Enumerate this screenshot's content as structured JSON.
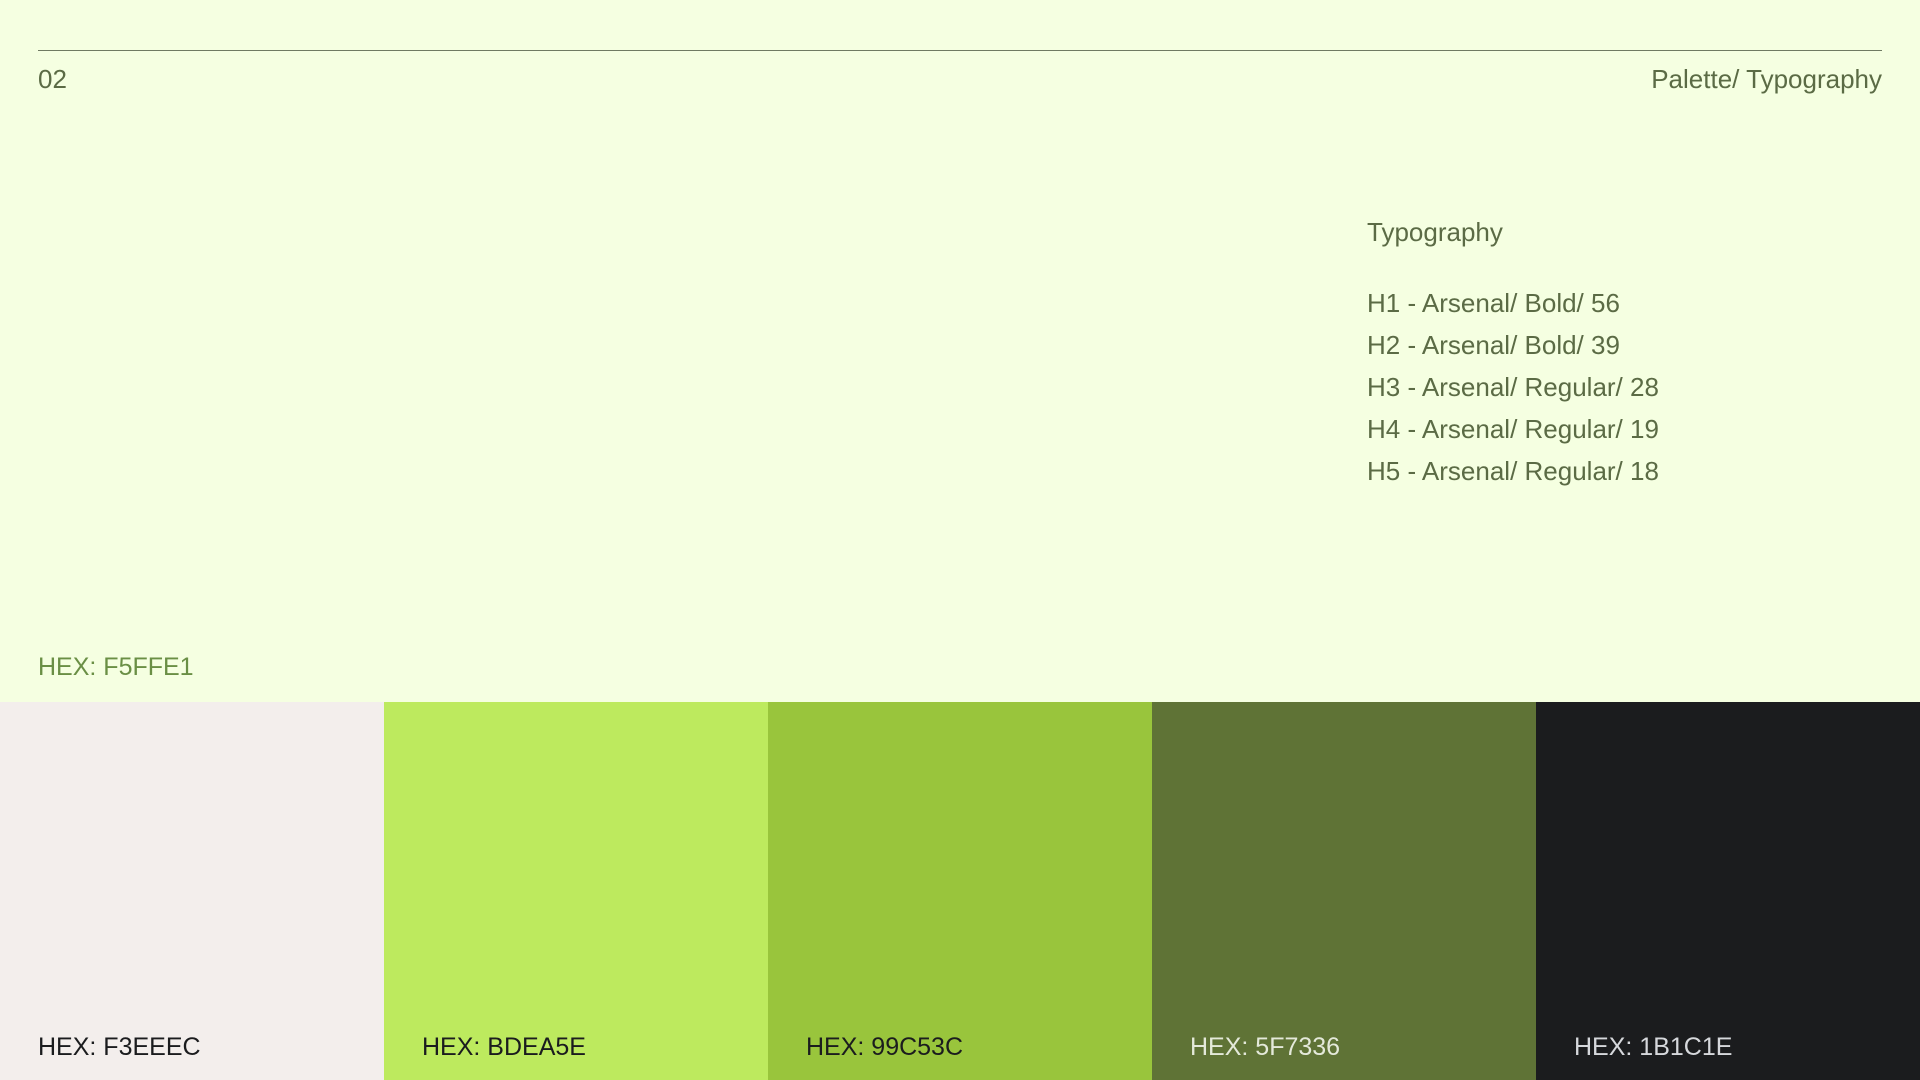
{
  "header": {
    "page_number": "02",
    "section_title": "Palette/ Typography"
  },
  "typography": {
    "heading": "Typography",
    "items": [
      "H1 - Arsenal/ Bold/ 56",
      "H2 - Arsenal/ Bold/ 39",
      "H3 - Arsenal/ Regular/ 28",
      "H4 - Arsenal/ Regular/ 19",
      "H5 - Arsenal/ Regular/ 18"
    ]
  },
  "palette": {
    "background": {
      "label": "HEX: F5FFE1",
      "color": "#F5FFE1"
    },
    "swatches": [
      {
        "label": "HEX: F3EEEC",
        "color": "#F3EEEC",
        "text_color": "#1B1C1E"
      },
      {
        "label": "HEX: BDEA5E",
        "color": "#BDEA5E",
        "text_color": "#1B1C1E"
      },
      {
        "label": "HEX: 99C53C",
        "color": "#99C53C",
        "text_color": "#1B1C1E"
      },
      {
        "label": "HEX: 5F7336",
        "color": "#5F7336",
        "text_color": "#E4E9DA"
      },
      {
        "label": "HEX: 1B1C1E",
        "color": "#1B1C1E",
        "text_color": "#D6D8DC"
      }
    ]
  }
}
